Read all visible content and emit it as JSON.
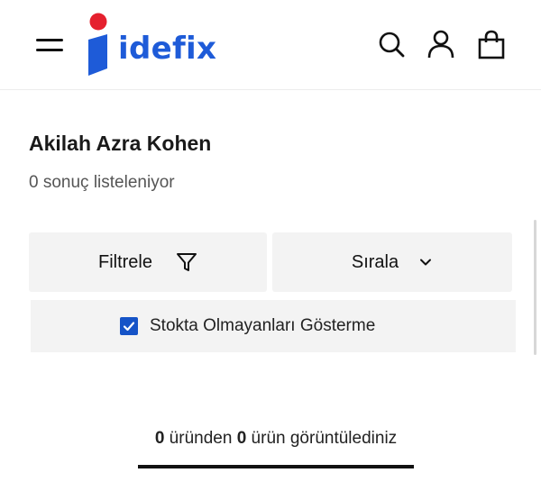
{
  "header": {
    "logo_text": "idefix",
    "menu_icon": "hamburger-menu-icon",
    "search_icon": "search-icon",
    "account_icon": "user-icon",
    "cart_icon": "shopping-bag-icon",
    "brand_blue": "#1e5bd8",
    "brand_red": "#e5202e"
  },
  "page": {
    "title": "Akilah Azra Kohen",
    "result_count": "0 sonuç listeleniyor"
  },
  "controls": {
    "filter_label": "Filtrele",
    "filter_icon": "funnel-icon",
    "sort_label": "Sırala",
    "sort_icon": "chevron-down-icon"
  },
  "stock_filter": {
    "label": "Stokta Olmayanları Gösterme",
    "checked": true
  },
  "pagination": {
    "viewed_count": "0",
    "viewed_middle": " üründen ",
    "total_count": "0",
    "viewed_suffix": " ürün görüntülediniz",
    "progress_fraction": 1.0
  }
}
